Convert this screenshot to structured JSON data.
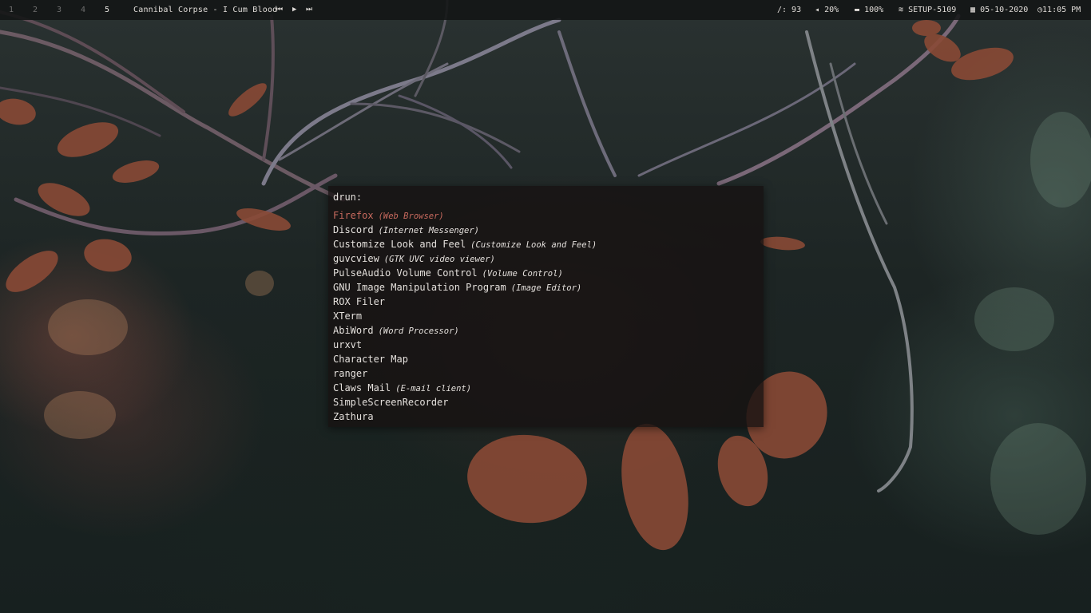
{
  "topbar": {
    "workspaces": [
      "1",
      "2",
      "3",
      "4",
      "5"
    ],
    "active_workspace": "5",
    "now_playing": "Cannibal Corpse - I Cum Blood",
    "media": {
      "prev_icon": "previous-track-icon",
      "play_icon": "play-icon",
      "next_icon": "next-track-icon",
      "prev_glyph": "⏮",
      "play_glyph": "▶",
      "next_glyph": "⏭"
    },
    "disk": "/: 93",
    "volume": "20%",
    "battery": "100%",
    "wifi": "SETUP-5109",
    "date": "05-10-2020",
    "time": "11:05 PM",
    "icons": {
      "volume_glyph": "◂",
      "battery_glyph": "▬",
      "wifi_glyph": "≋",
      "date_glyph": "▦",
      "time_glyph": "◷"
    }
  },
  "launcher": {
    "prompt": "drun:",
    "input_value": "",
    "selected_index": 0,
    "entries": [
      {
        "name": "Firefox",
        "generic": "(Web Browser)"
      },
      {
        "name": "Discord",
        "generic": "(Internet Messenger)"
      },
      {
        "name": "Customize Look and Feel",
        "generic": "(Customize Look and Feel)"
      },
      {
        "name": "guvcview",
        "generic": "(GTK UVC video viewer)"
      },
      {
        "name": "PulseAudio Volume Control",
        "generic": "(Volume Control)"
      },
      {
        "name": "GNU Image Manipulation Program",
        "generic": "(Image Editor)"
      },
      {
        "name": "ROX Filer",
        "generic": ""
      },
      {
        "name": "XTerm",
        "generic": ""
      },
      {
        "name": "AbiWord",
        "generic": "(Word Processor)"
      },
      {
        "name": "urxvt",
        "generic": ""
      },
      {
        "name": "Character Map",
        "generic": ""
      },
      {
        "name": "ranger",
        "generic": ""
      },
      {
        "name": "Claws Mail",
        "generic": "(E-mail client)"
      },
      {
        "name": "SimpleScreenRecorder",
        "generic": ""
      },
      {
        "name": "Zathura",
        "generic": ""
      }
    ]
  },
  "colors": {
    "accent": "#c86a5e",
    "text": "#e4e0dc",
    "bar_bg": "#121414"
  }
}
